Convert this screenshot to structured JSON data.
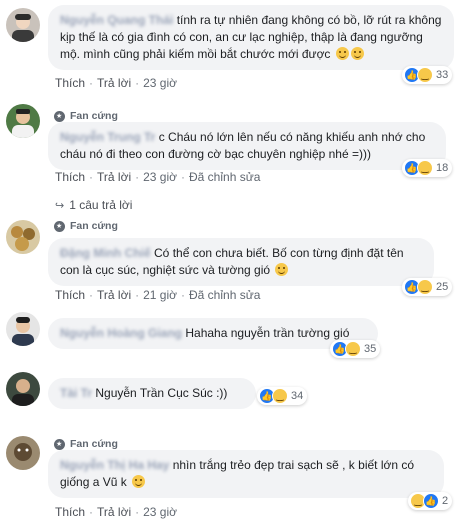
{
  "comments": [
    {
      "author": "Nguyễn Quang Thái",
      "text": "tính ra tự nhiên đang không có bồ, lỡ rút ra không kịp thế là có gia đình có con, an cư lạc nghiệp, thập là đang ngưỡng mộ. mình cũng phải kiếm mồi bắt chước mới được",
      "actions": {
        "like": "Thích",
        "reply": "Trả lời",
        "time": "23 giờ"
      },
      "reaction_count": "33"
    },
    {
      "badge": "Fan cứng",
      "author": "Nguyễn Trung Tr",
      "text": "c Cháu nó lớn lên nếu có năng khiếu anh nhớ cho cháu nó đi theo con đường cờ bạc chuyên nghiệp nhé =)))",
      "actions": {
        "like": "Thích",
        "reply": "Trả lời",
        "time": "23 giờ",
        "edited": "Đã chỉnh sửa"
      },
      "reaction_count": "18",
      "replies_link": "1 câu trả lời"
    },
    {
      "badge": "Fan cứng",
      "author": "Đặng Minh Chiế",
      "text": "Có thể con chưa biết. Bố con từng định đặt tên con là cục súc, nghiệt sức và tường gió",
      "actions": {
        "like": "Thích",
        "reply": "Trả lời",
        "time": "21 giờ",
        "edited": "Đã chỉnh sửa"
      },
      "reaction_count": "25"
    },
    {
      "author": "Nguyễn Hoàng Giang",
      "text": "Hahaha nguyễn trần tường gió",
      "reaction_count": "35"
    },
    {
      "author": "Tài Tr",
      "text": "Nguyễn Trần Cục Súc :))",
      "reaction_count": "34"
    },
    {
      "badge": "Fan cứng",
      "author": "Nguyễn Thị Ha Hay",
      "text": "nhìn trắng trẻo đẹp trai sạch sẽ , k biết lớn có giống a Vũ k",
      "actions": {
        "like": "Thích",
        "reply": "Trả lời",
        "time": "23 giờ"
      },
      "reaction_count": "2"
    }
  ],
  "colors": {
    "bubble": "#f2f3f5",
    "like": "#2078f4",
    "haha": "#f7c84a",
    "author": "#385898",
    "meta": "#606770"
  },
  "icons": [
    "like-icon",
    "haha-icon",
    "fan-badge-icon",
    "reply-arrow-icon",
    "smiley-emoji"
  ]
}
